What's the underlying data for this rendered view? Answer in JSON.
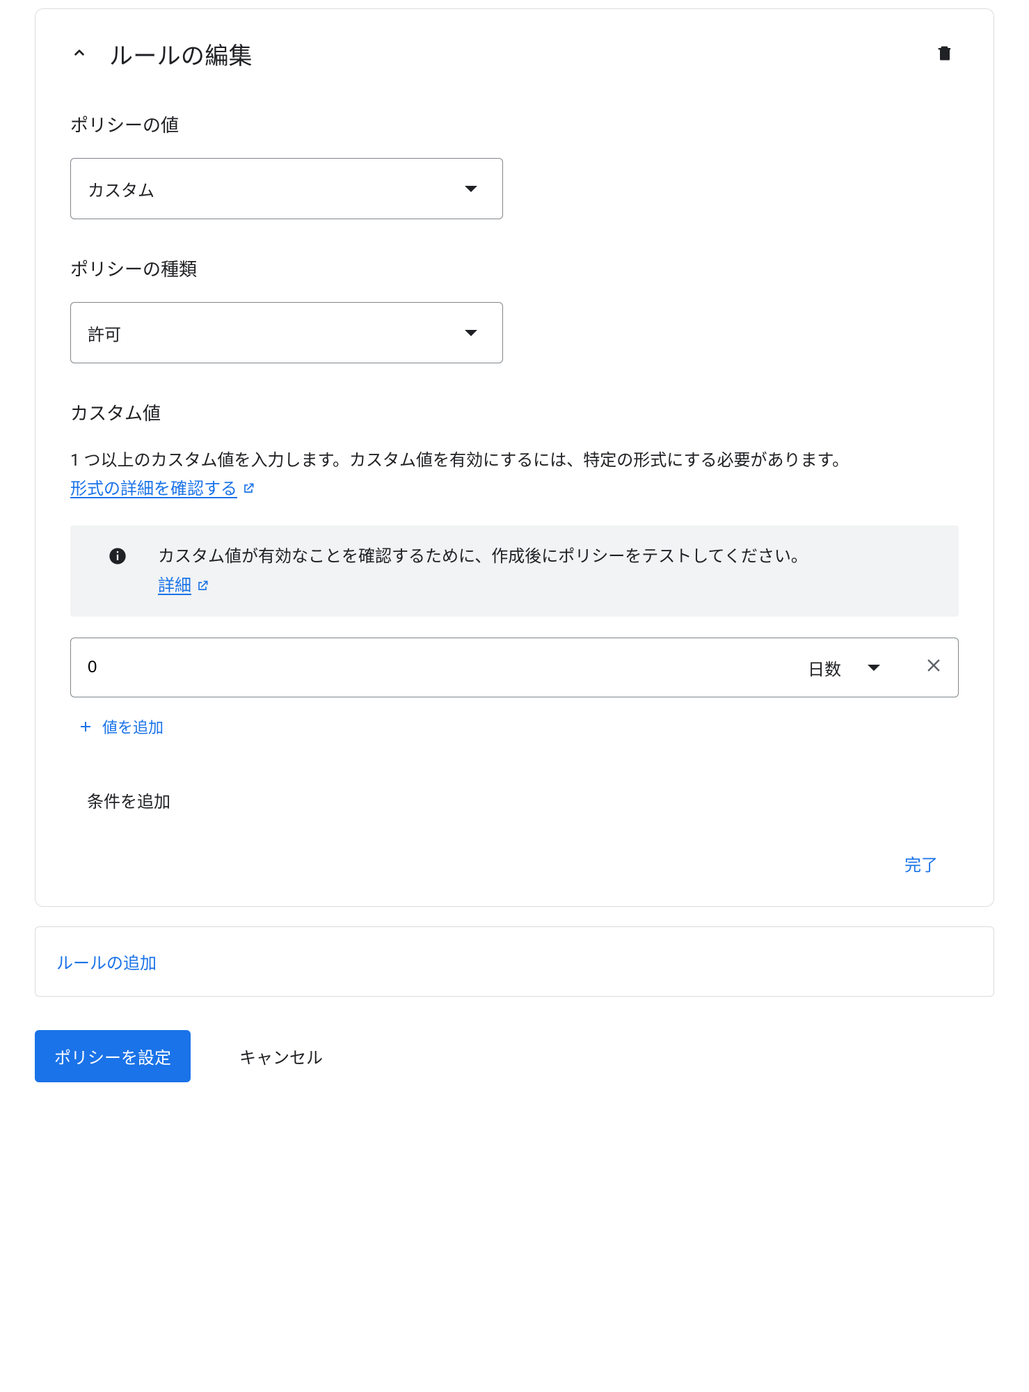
{
  "card": {
    "title": "ルールの編集"
  },
  "policy_value": {
    "label": "ポリシーの値",
    "selected": "カスタム"
  },
  "policy_type": {
    "label": "ポリシーの種類",
    "selected": "許可"
  },
  "custom": {
    "label": "カスタム値",
    "description_prefix": "1 つ以上のカスタム値を入力します。カスタム値を有効にするには、特定の形式にする必要があります。",
    "format_link": "形式の詳細を確認する"
  },
  "info": {
    "text": "カスタム値が有効なことを確認するために、作成後にポリシーをテストしてください。",
    "details_link": "詳細"
  },
  "value_row": {
    "value": "0",
    "unit": "日数"
  },
  "add_value": "値を追加",
  "add_condition": "条件を追加",
  "done": "完了",
  "add_rule": "ルールの追加",
  "actions": {
    "set_policy": "ポリシーを設定",
    "cancel": "キャンセル"
  }
}
